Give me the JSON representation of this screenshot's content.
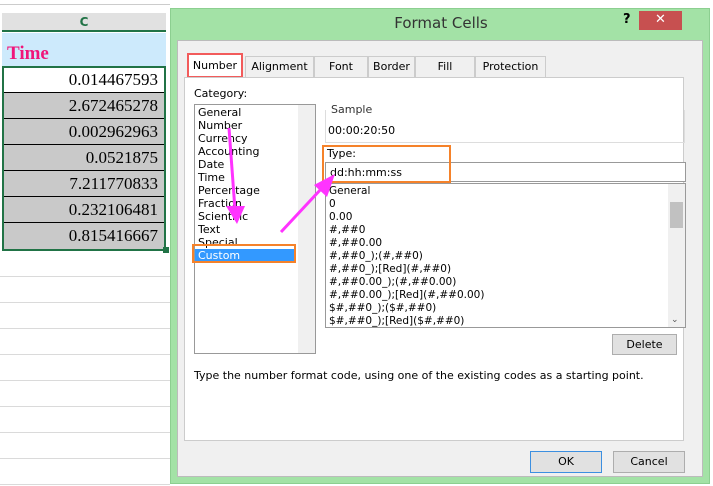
{
  "sheet": {
    "column": "C",
    "header": "Time",
    "values": [
      "0.014467593",
      "2.672465278",
      "0.002962963",
      "0.0521875",
      "7.211770833",
      "0.232106481",
      "0.815416667"
    ]
  },
  "dialog": {
    "title": "Format Cells",
    "help": "?",
    "close": "✕",
    "tabs": [
      "Number",
      "Alignment",
      "Font",
      "Border",
      "Fill",
      "Protection"
    ],
    "category_label": "Category:",
    "categories": [
      "General",
      "Number",
      "Currency",
      "Accounting",
      "Date",
      "Time",
      "Percentage",
      "Fraction",
      "Scientific",
      "Text",
      "Special",
      "Custom"
    ],
    "sample_label": "Sample",
    "sample_value": "00:00:20:50",
    "type_label": "Type:",
    "type_value": "dd:hh:mm:ss",
    "formats": [
      "General",
      "0",
      "0.00",
      "#,##0",
      "#,##0.00",
      "#,##0_);(#,##0)",
      "#,##0_);[Red](#,##0)",
      "#,##0.00_);(#,##0.00)",
      "#,##0.00_);[Red](#,##0.00)",
      "$#,##0_);($#,##0)",
      "$#,##0_);[Red]($#,##0)"
    ],
    "delete": "Delete",
    "description": "Type the number format code, using one of the existing codes as a starting point.",
    "ok": "OK",
    "cancel": "Cancel"
  },
  "colors": {
    "dialog_border": "#a3e2a6",
    "highlight": "#3399ff",
    "annotation_orange": "#f5822a",
    "annotation_red": "#f25b5b",
    "arrow": "#ff33ff"
  }
}
